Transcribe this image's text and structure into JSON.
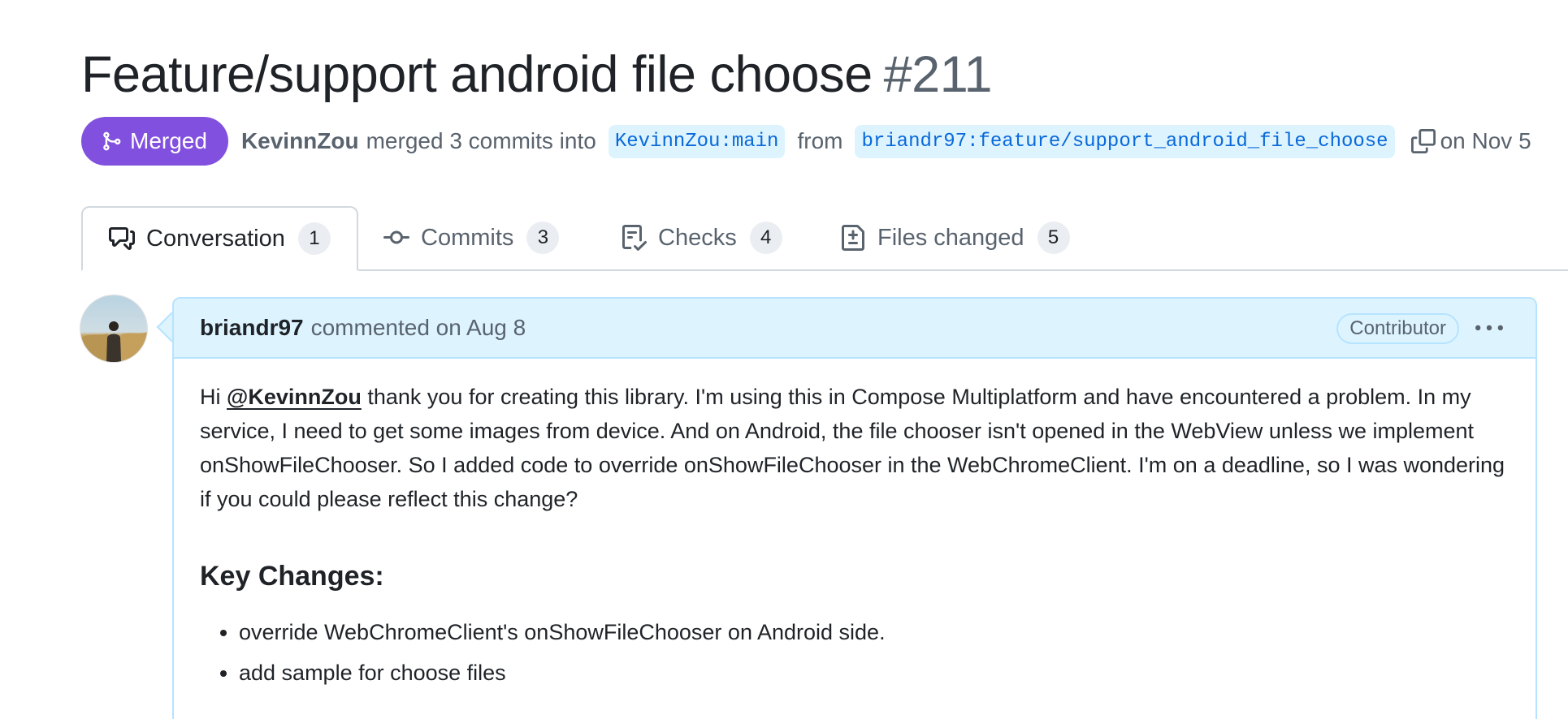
{
  "pr": {
    "title": "Feature/support android file choose",
    "number": "#211",
    "state": "Merged",
    "merged_by": "KevinnZou",
    "merge_text": "merged 3 commits into",
    "base_branch": "KevinnZou:main",
    "from_text": "from",
    "head_branch": "briandr97:feature/support_android_file_choose",
    "date_text": "on Nov 5",
    "state_color": "#8250df"
  },
  "tabs": [
    {
      "label": "Conversation",
      "count": "1",
      "icon": "comment-discussion-icon",
      "active": true
    },
    {
      "label": "Commits",
      "count": "3",
      "icon": "git-commit-icon",
      "active": false
    },
    {
      "label": "Checks",
      "count": "4",
      "icon": "checklist-icon",
      "active": false
    },
    {
      "label": "Files changed",
      "count": "5",
      "icon": "file-diff-icon",
      "active": false
    }
  ],
  "comment": {
    "author": "briandr97",
    "action": "commented on Aug 8",
    "role": "Contributor",
    "mention": "@KevinnZou",
    "greeting": "Hi",
    "para_after_mention": "thank you for creating this library. I'm using this in Compose Multiplatform and have encountered a problem. In my service, I need to get some images from device. And on Android, the file chooser isn't opened in the WebView unless we implement onShowFileChooser. So I added code to override onShowFileChooser in the WebChromeClient. I'm on a deadline, so I was wondering if you could please reflect this change?",
    "heading": "Key Changes:",
    "changes": [
      "override WebChromeClient's onShowFileChooser on Android side.",
      "add sample for choose files"
    ],
    "header_bg": "#ddf4ff",
    "border_color": "#b6e3ff"
  }
}
